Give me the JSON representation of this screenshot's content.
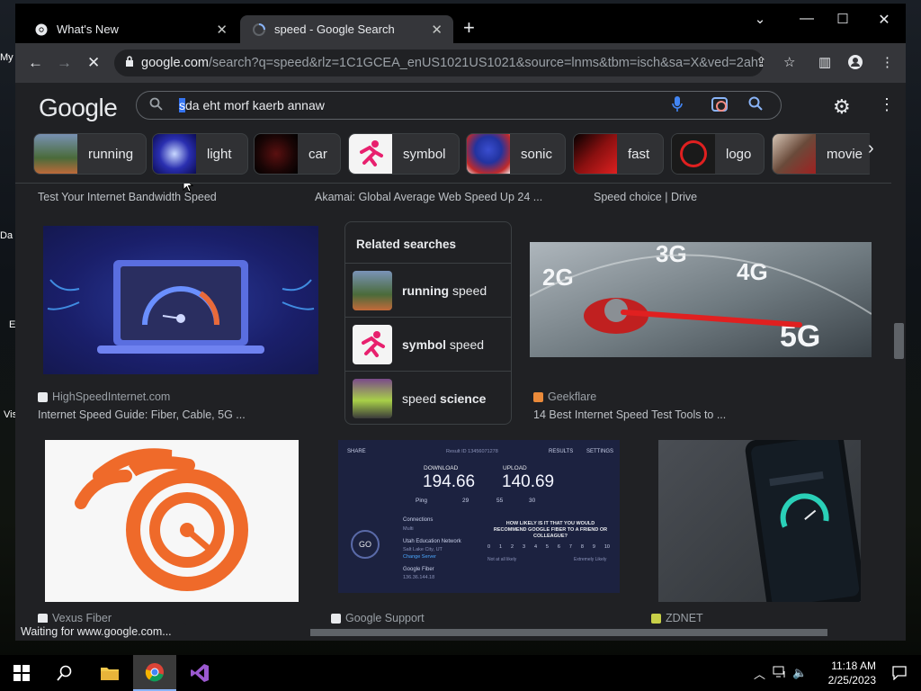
{
  "desktop": {
    "icons": [
      "My",
      "Da",
      "E",
      "Vis"
    ]
  },
  "browser": {
    "tabs": [
      {
        "title": "What's New"
      },
      {
        "title": "speed - Google Search"
      }
    ],
    "url_host": "google.com",
    "url_path": "/search?q=speed&rlz=1C1GCEA_enUS1021US1021&source=lnms&tbm=isch&sa=X&ved=2ah...",
    "status_text": "Waiting for www.google.com..."
  },
  "google": {
    "logo": "Google",
    "query_cursor": "s",
    "query_rest": "da eht morf kaerb annaw",
    "chips": [
      {
        "label": "running",
        "color": "#4a6b3a"
      },
      {
        "label": "light",
        "color": "#2a2fb0"
      },
      {
        "label": "car",
        "color": "#3b0e0e"
      },
      {
        "label": "symbol",
        "color": "#f4f4f4"
      },
      {
        "label": "sonic",
        "color": "#c02a2a"
      },
      {
        "label": "fast",
        "color": "#8a1010"
      },
      {
        "label": "logo",
        "color": "#1a1a1a"
      },
      {
        "label": "movie",
        "color": "#6a4a3a"
      }
    ]
  },
  "results": {
    "top_captions": [
      "Test Your Internet Bandwidth Speed",
      "Akamai: Global Average Web Speed Up 24 ...",
      "Speed choice | Drive"
    ],
    "row2": [
      {
        "source": "HighSpeedInternet.com",
        "title": "Internet Speed Guide: Fiber, Cable, 5G ..."
      },
      {
        "source": "Geekflare",
        "title": "14 Best Internet Speed Test Tools to ..."
      }
    ],
    "related": {
      "heading": "Related searches",
      "items": [
        {
          "a": "running",
          "b": " speed",
          "bold_first": true
        },
        {
          "a": "symbol",
          "b": " speed",
          "bold_first": true
        },
        {
          "a": "speed ",
          "b": "science",
          "bold_first": false
        }
      ]
    },
    "speedtest": {
      "download_label": "DOWNLOAD",
      "download": "194.66",
      "upload_label": "UPLOAD",
      "upload": "140.69",
      "go": "GO",
      "ping_label": "Ping",
      "ping": "29",
      "jitter1": "55",
      "jitter2": "30",
      "share": "SHARE",
      "results": "RESULTS",
      "settings": "SETTINGS",
      "result_id": "Result ID 13456071278",
      "connections": "Connections",
      "multi": "Multi",
      "isp": "Utah Education Network",
      "city": "Salt Lake City, UT",
      "change_server": "Change Server",
      "host": "Google Fiber",
      "ip": "136.36.144.18",
      "survey": "HOW LIKELY IS IT THAT YOU WOULD RECOMMEND GOOGLE FIBER TO A FRIEND OR COLLEAGUE?",
      "not_likely": "Not at all likely",
      "extremely": "Extremely Likely",
      "scale": [
        "0",
        "1",
        "2",
        "3",
        "4",
        "5",
        "6",
        "7",
        "8",
        "9",
        "10"
      ]
    },
    "row3_sources": [
      "Vexus Fiber",
      "Google Support",
      "ZDNET"
    ],
    "speedo_labels": [
      "2G",
      "3G",
      "4G",
      "5G"
    ]
  },
  "taskbar": {
    "time": "11:18 AM",
    "date": "2/25/2023"
  }
}
